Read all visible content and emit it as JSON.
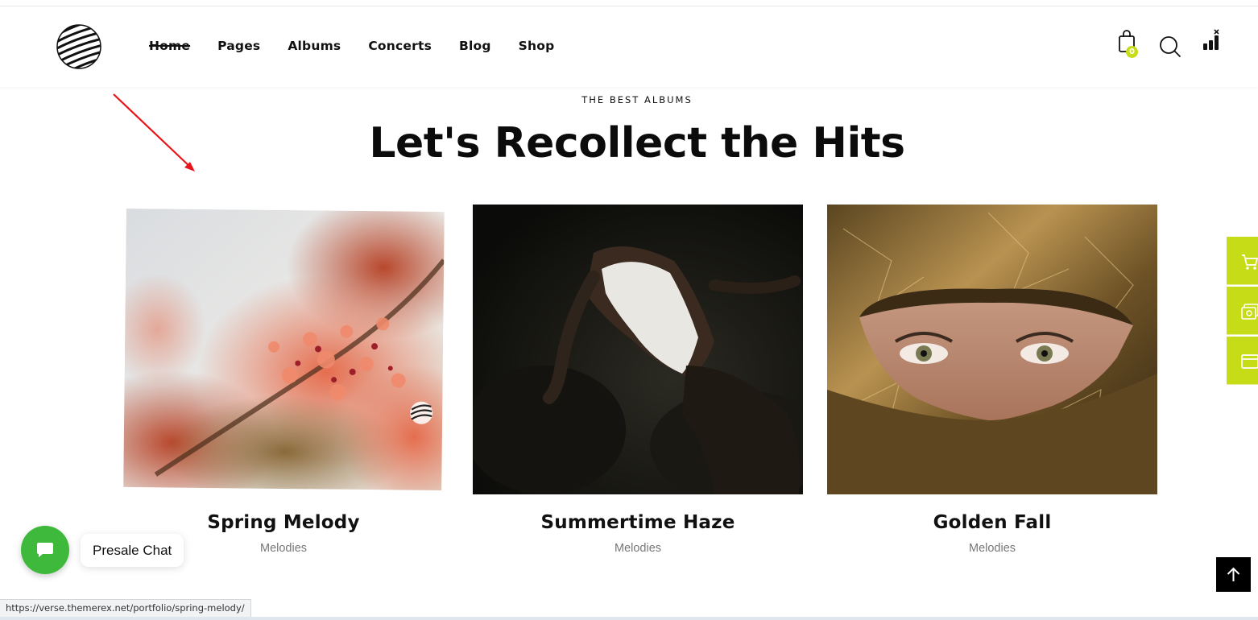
{
  "nav": {
    "items": [
      "Home",
      "Pages",
      "Albums",
      "Concerts",
      "Blog",
      "Shop"
    ],
    "active": "Home"
  },
  "header": {
    "cart_count": "0",
    "icons": [
      "logo-sphere-icon",
      "shopping-bag-icon",
      "search-icon",
      "menu-bars-icon"
    ]
  },
  "section": {
    "eyebrow": "THE BEST ALBUMS",
    "title": "Let's Recollect the Hits"
  },
  "albums": [
    {
      "title": "Spring Melody",
      "category": "Melodies",
      "image": "blossom branches photo"
    },
    {
      "title": "Summertime Haze",
      "category": "Melodies",
      "image": "woman in swimsuit on dark rocks photo"
    },
    {
      "title": "Golden Fall",
      "category": "Melodies",
      "image": "face wrapped in gold foil photo"
    }
  ],
  "side_panel": {
    "icons": [
      "cart-icon",
      "gallery-icon",
      "window-icon"
    ]
  },
  "chat": {
    "label": "Presale Chat"
  },
  "status_bar": {
    "url": "https://verse.themerex.net/portfolio/spring-melody/"
  },
  "colors": {
    "accent": "#c6dc16",
    "chat": "#3fb93c",
    "text": "#0b0b0b",
    "muted": "#777777"
  }
}
